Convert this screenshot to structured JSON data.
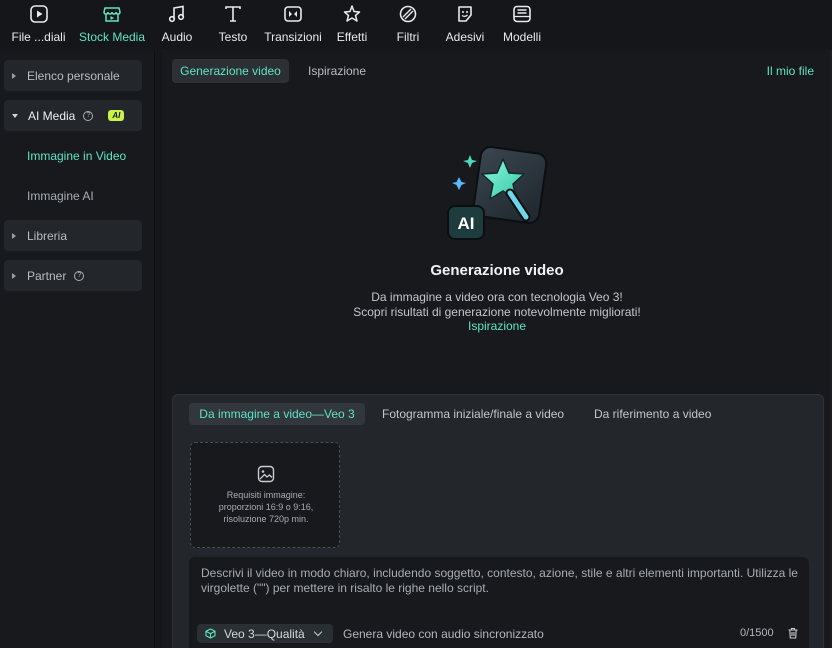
{
  "toolbar": {
    "items": [
      {
        "label": "File ...diali",
        "icon": "media-icon"
      },
      {
        "label": "Stock Media",
        "icon": "stock-media-icon",
        "active": true
      },
      {
        "label": "Audio",
        "icon": "music-icon"
      },
      {
        "label": "Testo",
        "icon": "text-icon"
      },
      {
        "label": "Transizioni",
        "icon": "transitions-icon"
      },
      {
        "label": "Effetti",
        "icon": "effects-icon"
      },
      {
        "label": "Filtri",
        "icon": "filters-icon"
      },
      {
        "label": "Adesivi",
        "icon": "stickers-icon"
      },
      {
        "label": "Modelli",
        "icon": "templates-icon"
      }
    ]
  },
  "sidebar": {
    "personal": "Elenco personale",
    "ai_media": "AI Media",
    "ai_badge": "AI",
    "image_to_video": "Immagine in Video",
    "ai_image": "Immagine AI",
    "library": "Libreria",
    "partner": "Partner"
  },
  "main": {
    "tab_generation": "Generazione video",
    "tab_inspiration": "Ispirazione",
    "my_files": "Il mio file",
    "hero_title": "Generazione video",
    "hero_line1": "Da immagine a video ora con tecnologia Veo 3!",
    "hero_line2": "Scopri risultati di generazione notevolmente migliorati!",
    "hero_link": "Ispirazione",
    "hero_icon_text": "AI"
  },
  "panel": {
    "tabs": [
      "Da immagine a video—Veo 3",
      "Fotogramma iniziale/finale a video",
      "Da riferimento a video"
    ],
    "upload_lines": [
      "Requisiti immagine:",
      "proporzioni 16:9 o 9:16,",
      "risoluzione 720p min."
    ],
    "prompt_placeholder": "Descrivi il video in modo chiaro, includendo soggetto, contesto, azione, stile e altri elementi importanti. Utilizza le virgolette (\"\") per mettere in risalto le righe nello script.",
    "model_label": "Veo 3—Qualità",
    "audio_label": "Genera video con audio sincronizzato",
    "counter": "0/1500"
  },
  "colors": {
    "accent": "#5fe3c4",
    "ai_badge": "#c9f24b",
    "background": "#17191c",
    "panel": "#23272c"
  }
}
